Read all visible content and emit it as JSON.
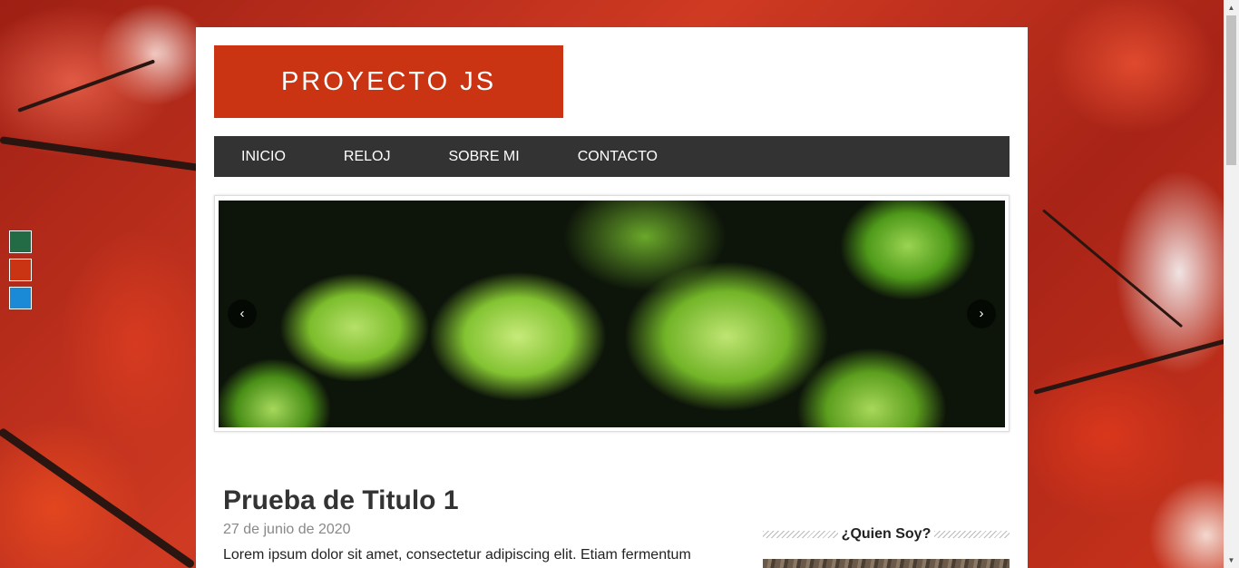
{
  "site": {
    "logo_text": "PROYECTO JS"
  },
  "nav": {
    "items": [
      "INICIO",
      "RELOJ",
      "SOBRE MI",
      "CONTACTO"
    ]
  },
  "theme_swatches": [
    {
      "name": "green",
      "color": "#226b45"
    },
    {
      "name": "red",
      "color": "#cb3413"
    },
    {
      "name": "blue",
      "color": "#1b8ad6"
    }
  ],
  "slider": {
    "prev_label": "‹",
    "next_label": "›"
  },
  "article": {
    "title": "Prueba de Titulo 1",
    "date": "27 de junio de 2020",
    "excerpt": "Lorem ipsum dolor sit amet, consectetur adipiscing elit. Etiam fermentum"
  },
  "sidebar": {
    "widget_title": "¿Quien Soy?"
  },
  "colors": {
    "accent": "#cb3413",
    "nav_bg": "#333333"
  }
}
